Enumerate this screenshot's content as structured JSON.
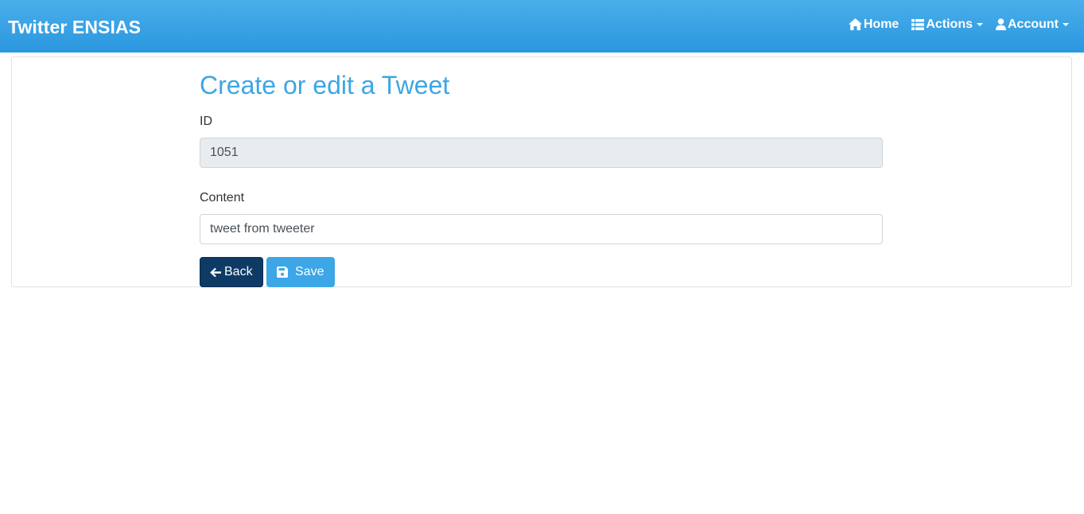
{
  "navbar": {
    "brand": "Twitter ENSIAS",
    "items": [
      {
        "label": "Home",
        "icon": "home-icon",
        "dropdown": false
      },
      {
        "label": "Actions",
        "icon": "list-icon",
        "dropdown": true
      },
      {
        "label": "Account",
        "icon": "user-icon",
        "dropdown": true
      }
    ]
  },
  "form": {
    "title": "Create or edit a Tweet",
    "id_label": "ID",
    "id_value": "1051",
    "content_label": "Content",
    "content_value": "tweet from tweeter"
  },
  "buttons": {
    "back_label": "Back",
    "save_label": "Save"
  },
  "colors": {
    "navbar_top": "#4aaee9",
    "navbar_bottom": "#2b97e0",
    "title": "#3ca6e6",
    "back_button": "#0e3a66",
    "save_button": "#3ca6e6",
    "readonly_input": "#e9ecef"
  }
}
